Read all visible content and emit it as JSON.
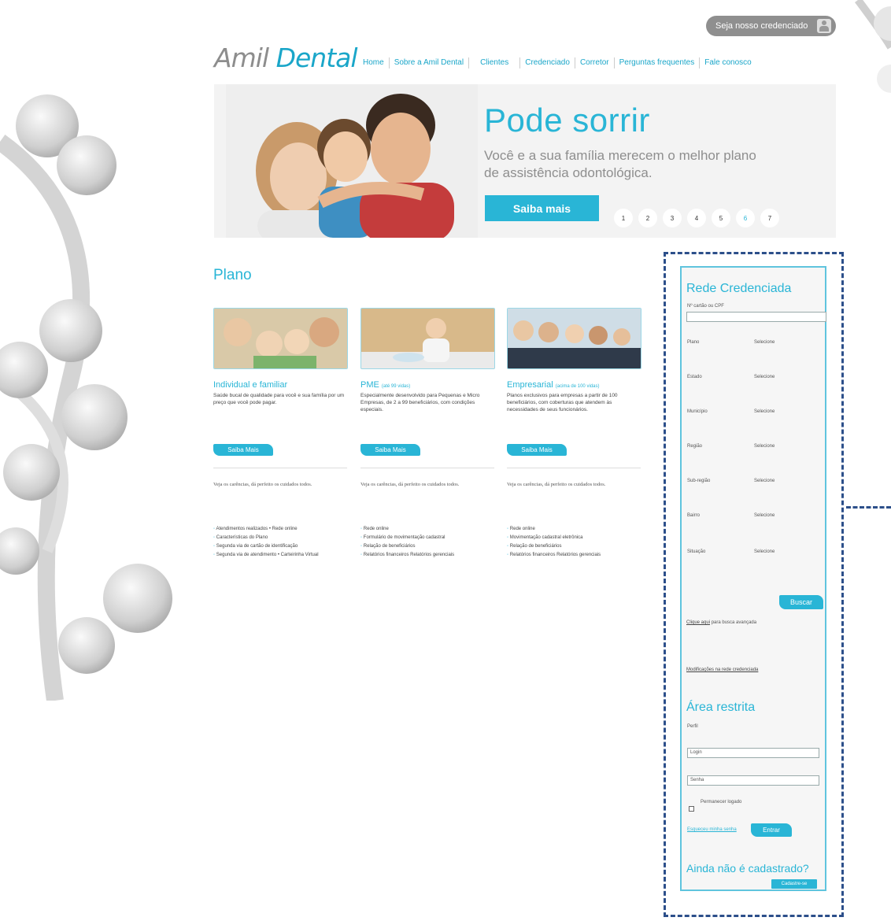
{
  "topbar": {
    "credenciado_label": "Seja nosso credenciado"
  },
  "logo": {
    "amil": "Amil",
    "dental": "Dental"
  },
  "nav": [
    "Home",
    "Sobre a Amil Dental",
    "Clientes",
    "Credenciado",
    "Corretor",
    "Perguntas frequentes",
    "Fale conosco"
  ],
  "hero": {
    "title": "Pode sorrir",
    "subtitle": "Você e a sua família merecem o melhor plano de assistência odontológica.",
    "button": "Saiba mais",
    "pages": [
      "1",
      "2",
      "3",
      "4",
      "5",
      "6",
      "7"
    ],
    "active_page": "6"
  },
  "plano": {
    "title": "Plano",
    "plans": [
      {
        "title": "Individual e familiar",
        "title_note": "",
        "desc": "Saúde bucal de qualidade para você e sua família por um preço que você pode pagar.",
        "button": "Saiba Mais",
        "note": "Veja os carências, dá perfeito os cuidados todos.",
        "links": [
          "Atendimentos realizados • Rede online",
          "Características do Plano",
          "Segunda via de cartão de identificação",
          "Segunda via de atendimento • Carteirinha Virtual"
        ]
      },
      {
        "title": "PME",
        "title_note": "(até 99 vidas)",
        "desc": "Especialmente desenvolvido para Pequenas e Micro Empresas, de 2 a 99 beneficiários, com condições especiais.",
        "button": "Saiba Mais",
        "note": "Veja os carências, dá perfeito os cuidados todos.",
        "links": [
          "Rede online",
          "Formulário de movimentação cadastral",
          "Relação de beneficiários",
          "Relatórios financeiros Relatórios gerenciais"
        ]
      },
      {
        "title": "Empresarial",
        "title_note": "(acima de 100 vidas)",
        "desc": "Planos exclusivos para empresas a partir de 100 beneficiários, com coberturas que atendem às necessidades de seus funcionários.",
        "button": "Saiba Mais",
        "note": "Veja os carências, dá perfeito os cuidados todos.",
        "links": [
          "Rede online",
          "Movimentação cadastral eletrônica",
          "Relação de beneficiários",
          "Relatórios financeiros Relatórios gerenciais"
        ]
      }
    ]
  },
  "sidebar": {
    "rede_title": "Rede Credenciada",
    "cpf_label": "Nº cartão ou CPF",
    "cpf_value": "",
    "filters": [
      {
        "label": "Plano",
        "value": "Selecione"
      },
      {
        "label": "Estado",
        "value": "Selecione"
      },
      {
        "label": "Município",
        "value": "Selecione"
      },
      {
        "label": "Região",
        "value": "Selecione"
      },
      {
        "label": "Sub-região",
        "value": "Selecione"
      },
      {
        "label": "Bairro",
        "value": "Selecione"
      },
      {
        "label": "Situação",
        "value": "Selecione"
      }
    ],
    "buscar": "Buscar",
    "clique_link": "Clique aqui",
    "clique_rest": "para busca avançada",
    "modificacoes": "Modificações na rede credenciada",
    "area_title": "Área restrita",
    "perfil_label": "Perfil",
    "login_value": "Login",
    "senha_value": "Senha",
    "permanecer": "Permanecer logado",
    "esqueci": "Esqueceu minha senha",
    "entrar": "Entrar",
    "cadastro_title": "Ainda não é cadastrado?",
    "cadastrar": "Cadastre-se"
  },
  "colors": {
    "accent": "#29b5d6",
    "annotation": "#2c4f8a",
    "logo_gray": "#8d8d8d"
  }
}
